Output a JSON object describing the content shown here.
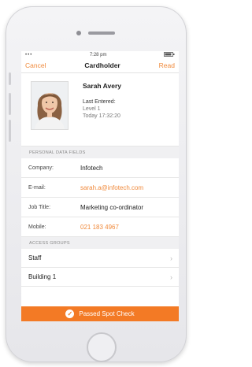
{
  "status_bar": {
    "signal": "•••",
    "time": "7:28 pm"
  },
  "nav": {
    "cancel": "Cancel",
    "title": "Cardholder",
    "read": "Read"
  },
  "profile": {
    "name": "Sarah Avery",
    "last_entered_label": "Last Entered:",
    "location": "Level 1",
    "time": "Today 17:32:20"
  },
  "personal": {
    "header": "PERSONAL DATA FIELDS",
    "rows": [
      {
        "label": "Company:",
        "value": "Infotech"
      },
      {
        "label": "E-mail:",
        "value": "sarah.a@infotech.com"
      },
      {
        "label": "Job Title:",
        "value": "Marketing co-ordinator"
      },
      {
        "label": "Mobile:",
        "value": "021 183 4967"
      }
    ]
  },
  "access": {
    "header": "ACCESS GROUPS",
    "items": [
      {
        "label": "Staff",
        "chevron": "›"
      },
      {
        "label": "Building 1",
        "chevron": "›"
      }
    ]
  },
  "footer": {
    "text": "Passed Spot Check",
    "check": "✓"
  },
  "colors": {
    "accent": "#f37a25",
    "link": "#f08a3c"
  }
}
